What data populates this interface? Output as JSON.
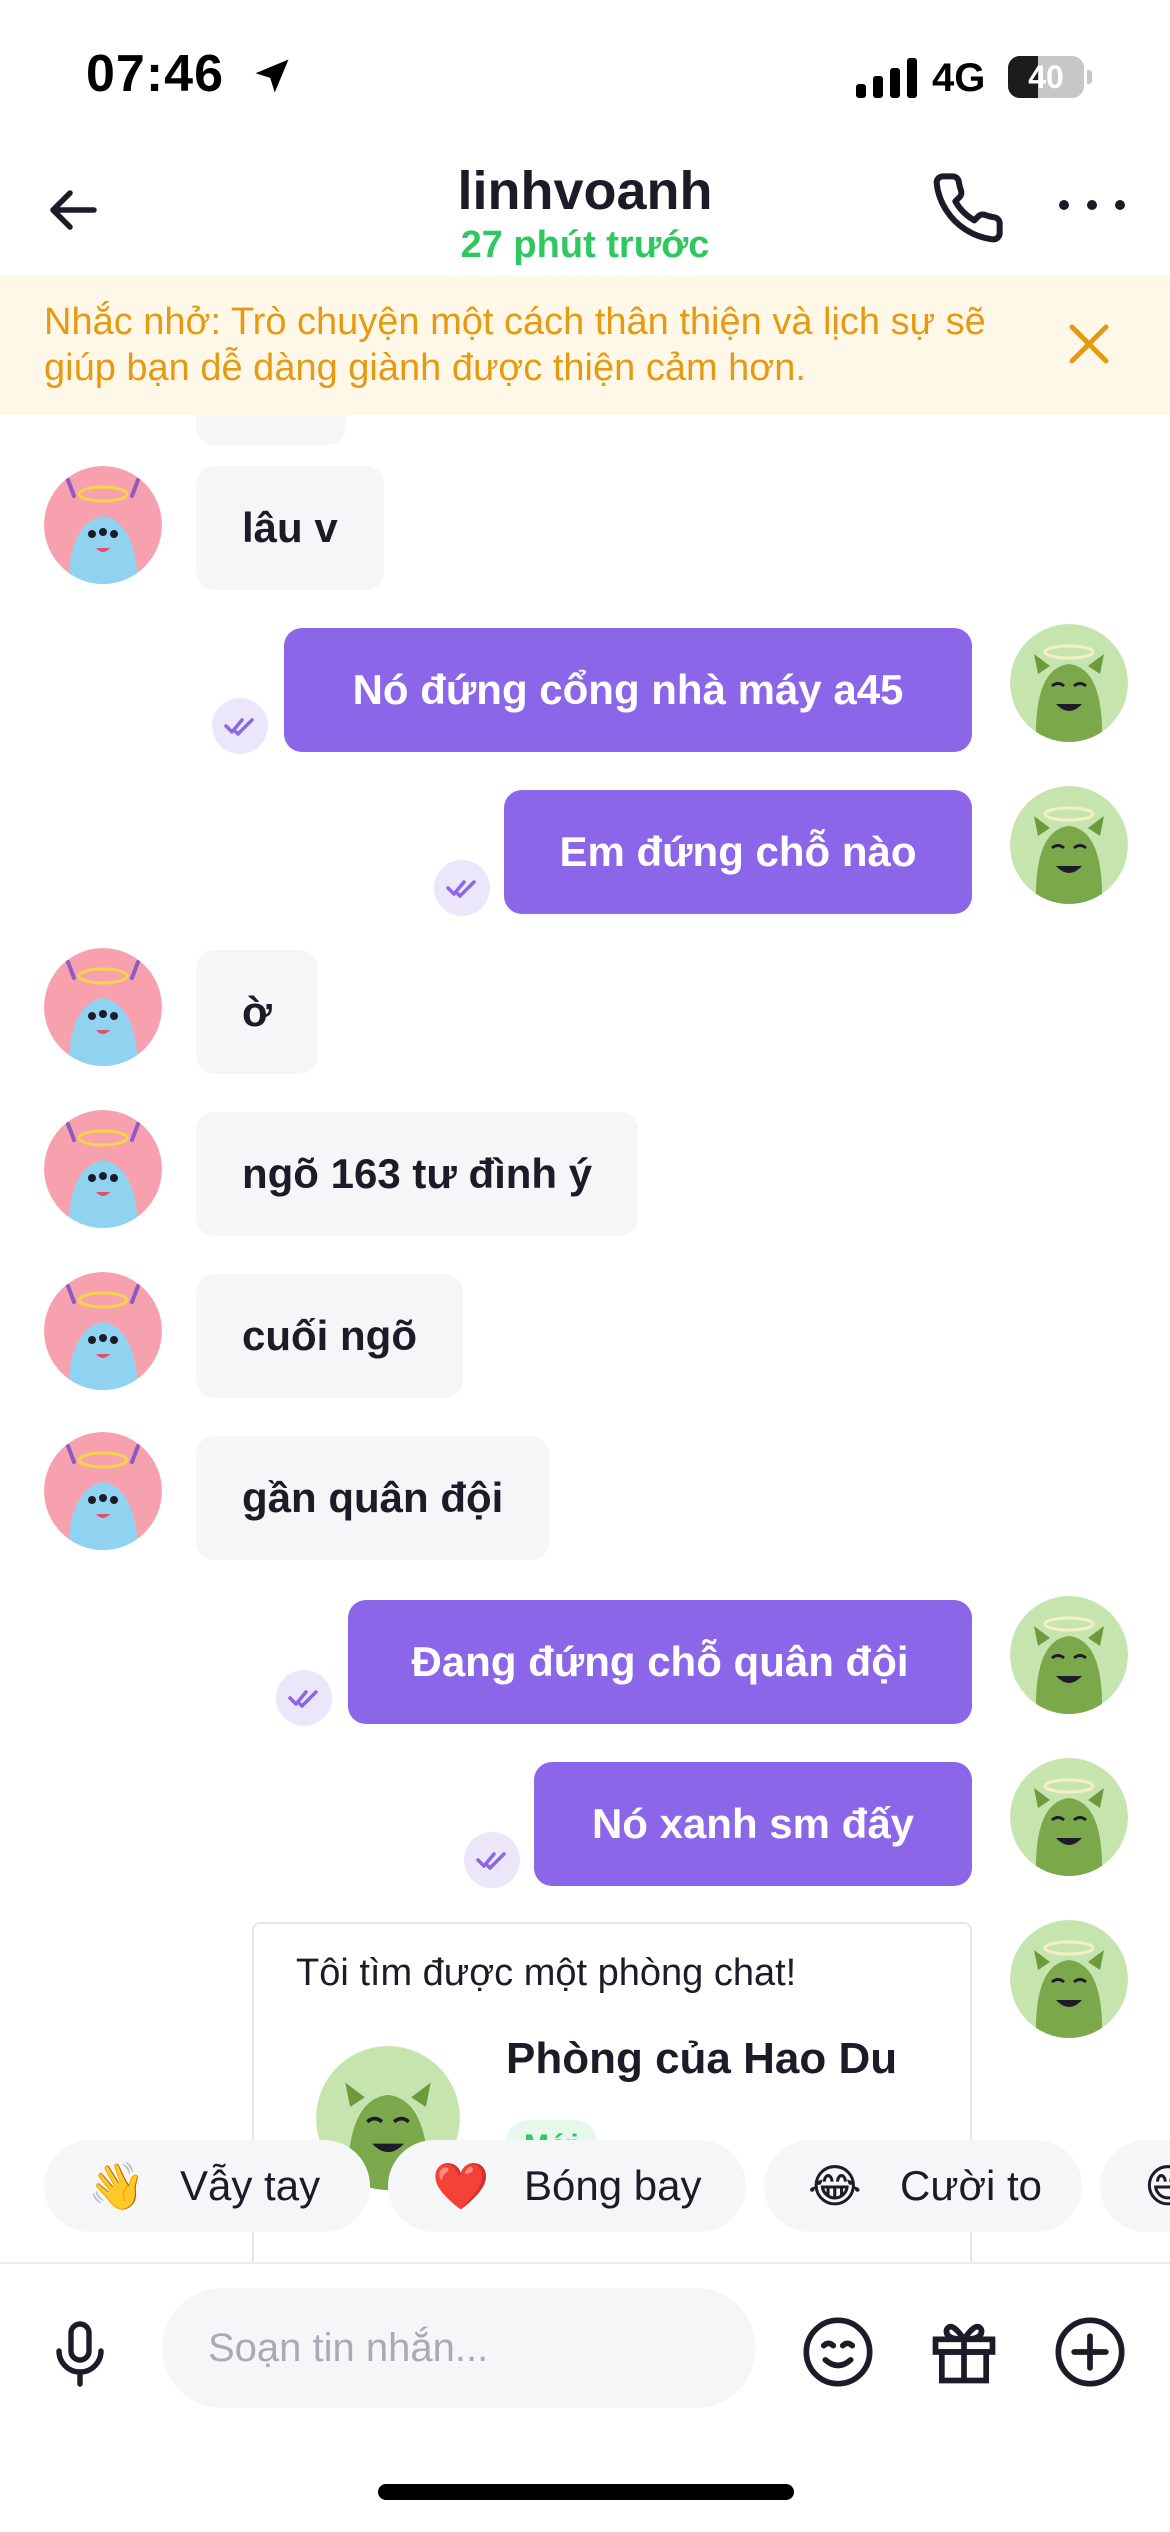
{
  "status_bar": {
    "time": "07:46",
    "network": "4G",
    "battery": "40",
    "battery_level": 0.4,
    "icons": [
      "location-arrow-icon",
      "cellular-signal-icon",
      "battery-icon"
    ]
  },
  "header": {
    "title": "linhvoanh",
    "subtitle": "27 phút trước",
    "subtitle_color": "#2fc860",
    "icons": [
      "back-arrow-icon",
      "phone-icon",
      "more-dots-icon"
    ]
  },
  "reminder": {
    "text": "Nhắc nhở: Trò chuyện một cách thân thiện và lịch sự sẽ giúp bạn dễ dàng giành được thiện cảm hơn.",
    "icon": "close-icon",
    "color": "#e59a12"
  },
  "messages": [
    {
      "from": "other",
      "text": "lâu v"
    },
    {
      "from": "me",
      "text": "Nó đứng cổng nhà máy a45",
      "status": "read"
    },
    {
      "from": "me",
      "text": "Em đứng chỗ nào",
      "status": "read"
    },
    {
      "from": "other",
      "text": "ờ"
    },
    {
      "from": "other",
      "text": "ngõ 163 tư đình ý"
    },
    {
      "from": "other",
      "text": "cuối ngõ"
    },
    {
      "from": "other",
      "text": "gần quân đội"
    },
    {
      "from": "me",
      "text": "Đang đứng chỗ quân đội",
      "status": "read"
    },
    {
      "from": "me",
      "text": "Nó xanh sm đấy",
      "status": "read"
    }
  ],
  "room_card": {
    "heading": "Tôi tìm được một phòng chat!",
    "title": "Phòng của Hao Du",
    "badge": "Mới"
  },
  "reactions": [
    {
      "emoji": "👋",
      "label": "Vẫy tay"
    },
    {
      "emoji": "❤️",
      "label": "Bóng bay"
    },
    {
      "emoji": "😂",
      "label": "Cười to"
    },
    {
      "emoji": "😄",
      "label": ""
    }
  ],
  "input": {
    "placeholder": "Soạn tin nhắn...",
    "icons": [
      "microphone-icon",
      "emoji-icon",
      "gift-icon",
      "plus-circle-icon"
    ]
  },
  "colors": {
    "accent": "#8b66e8",
    "incoming_bubble": "#f5f6f8",
    "banner_bg": "#fff8e8"
  }
}
